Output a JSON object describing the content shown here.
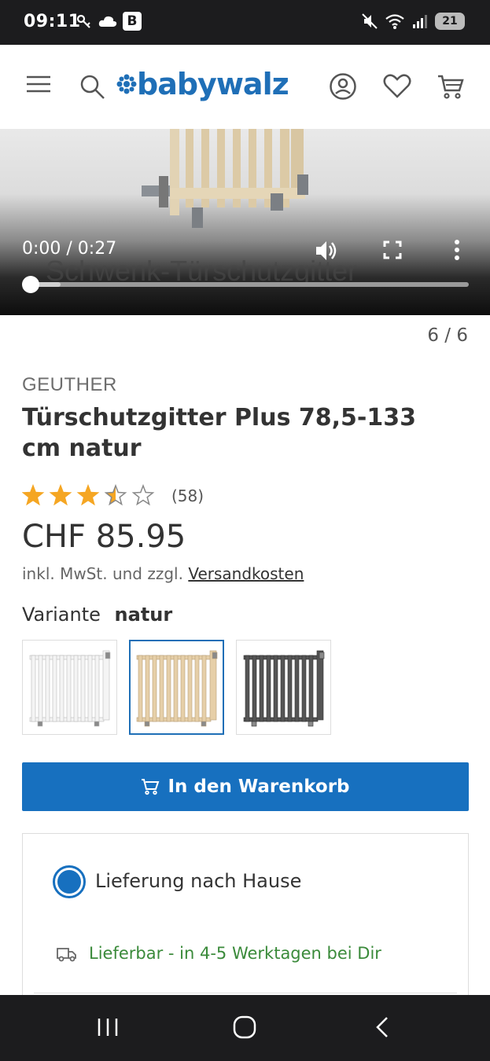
{
  "status_bar": {
    "time": "09:11",
    "badge": "B",
    "battery": "21"
  },
  "header": {
    "logo_text": "babywalz",
    "brand_color": "#1f6fb7",
    "icons": [
      "menu-icon",
      "search-icon",
      "account-icon",
      "heart-icon",
      "cart-icon"
    ]
  },
  "video": {
    "time_display": "0:00 / 0:27",
    "caption": "Schwenk-Türschutzgitter",
    "progress": 0,
    "buffered": 0.07
  },
  "gallery": {
    "counter": "6 / 6"
  },
  "product": {
    "brand": "GEUTHER",
    "title": "Türschutzgitter Plus 78,5-133 cm natur",
    "rating": 3.5,
    "review_count": "(58)",
    "price": "CHF 85.95",
    "tax_note": "inkl. MwSt. und zzgl.",
    "shipping_link": "Versandkosten",
    "variant_label": "Variante",
    "variant_value": "natur",
    "swatches": [
      {
        "name": "weiss",
        "color": "#f4f4f4",
        "selected": false
      },
      {
        "name": "natur",
        "color": "#e6cfa8",
        "selected": true
      },
      {
        "name": "anthrazit",
        "color": "#555555",
        "selected": false
      }
    ]
  },
  "cart_button": {
    "label": "In den Warenkorb",
    "color": "#1770bf"
  },
  "delivery": {
    "option_label": "Lieferung nach Hause",
    "availability": "Lieferbar - in 4-5 Werktagen bei Dir",
    "availability_color": "#3a8a3a"
  }
}
